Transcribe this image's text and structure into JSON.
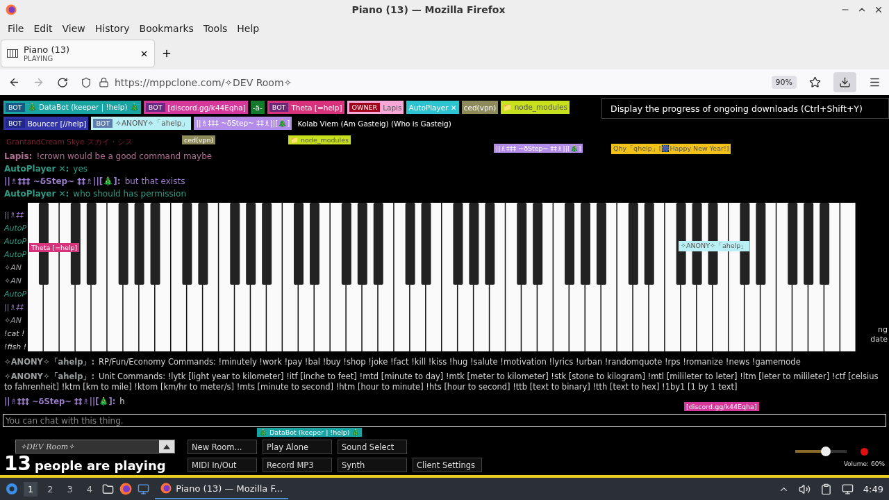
{
  "window": {
    "title": "Piano (13) — Mozilla Firefox"
  },
  "menu": [
    "File",
    "Edit",
    "View",
    "History",
    "Bookmarks",
    "Tools",
    "Help"
  ],
  "tab": {
    "title": "Piano (13)",
    "status": "PLAYING"
  },
  "address": {
    "url": "https://mppclone.com/✧DEV Room✧",
    "zoom": "90%"
  },
  "tooltip": "Display the progress of ongoing downloads (Ctrl+Shift+Y)",
  "users": [
    {
      "kind": "bot",
      "badge": "BOT",
      "name": "🎄 DataBot (keeper | !help) 🎄",
      "color": "#1aa3a3"
    },
    {
      "kind": "bot",
      "badge": "BOT",
      "name": "[discord.gg/k44Eqha]",
      "color": "#d6379b"
    },
    {
      "kind": "plain",
      "name": "-ä-",
      "color": "#127a2a"
    },
    {
      "kind": "bot",
      "badge": "BOT",
      "name": "Theta [=help]",
      "color": "#d8327d"
    },
    {
      "kind": "owner",
      "badge": "OWNER",
      "name": "Lapis",
      "color": "#f7a8d8"
    },
    {
      "kind": "plain",
      "name": "AutoPlayer ✕",
      "color": "#2ec4cf"
    },
    {
      "kind": "plain",
      "name": "ced(vpn)",
      "color": "#8f8a5a"
    },
    {
      "kind": "plain",
      "name": "📁 node_modules",
      "color": "#c8e01e"
    },
    {
      "kind": "bot",
      "badge": "BOT",
      "name": "Bouncer [//help]",
      "color": "#3034a8"
    },
    {
      "kind": "bot",
      "badge": "BOT",
      "name": "✧ANONY✧「ahelp」",
      "color": "#b8f0f5"
    },
    {
      "kind": "plain",
      "name": "||♗‡‡‡ ~δStep~ ‡‡♗||[🎄]",
      "color": "#b48de8"
    },
    {
      "kind": "text",
      "name": "Kolab Viem (Am Gasteig) (Who is Gasteig)",
      "color": "#ffffff"
    },
    {
      "kind": "text",
      "name": "GrantandCream Skye スカイ・シス",
      "color": "#7a2030"
    }
  ],
  "cursors": [
    {
      "name": "ced(vpn)",
      "color": "#8f8a5a"
    },
    {
      "name": "📁 node_modules",
      "color": "#c8e01e"
    },
    {
      "name": "||♗‡‡‡ ~δStep~ ‡‡♗||[🎄]",
      "color": "#b48de8"
    },
    {
      "name": "Qhy「qhelp」[🎆Happy New Year!]",
      "color": "#f2c21a"
    },
    {
      "name": "Theta [=help]",
      "color": "#d8327d"
    },
    {
      "name": "✧ANONY✧「ahelp」",
      "color": "#b8f0f5"
    },
    {
      "name": "[discord.gg/k44Eqha]",
      "color": "#d6379b"
    },
    {
      "name": "🎄 DataBot (keeper | !help) 🎄",
      "color": "#1aa3a3"
    }
  ],
  "chat": [
    {
      "name": "Lapis:",
      "text": "!crown would be a good command maybe",
      "color": "#b06f92"
    },
    {
      "name": "AutoPlayer ✕:",
      "text": "yes",
      "color": "#2e9c86"
    },
    {
      "name": "||♗‡‡‡ ~δStep~ ‡‡♗||[🎄]:",
      "text": "but that exists",
      "color": "#9c7ccc"
    },
    {
      "name": "AutoPlayer ✕:",
      "text": "who should has permission",
      "color": "#2e9c86"
    }
  ],
  "chat_fragments_left": [
    {
      "text": "||♗‡‡",
      "color": "#9c7ccc"
    },
    {
      "text": "AutoP",
      "color": "#2e9c86"
    },
    {
      "text": "AutoP",
      "color": "#2e9c86"
    },
    {
      "text": "AutoP",
      "color": "#2e9c86"
    },
    {
      "text": "✧AN",
      "color": "#9aa0a0"
    },
    {
      "text": "✧AN",
      "color": "#9aa0a0"
    },
    {
      "text": "AutoP",
      "color": "#2e9c86"
    },
    {
      "text": "||♗‡‡",
      "color": "#9c7ccc"
    },
    {
      "text": "✧AN",
      "color": "#9aa0a0"
    },
    {
      "text": "!cat !",
      "color": "#d8d8d8"
    },
    {
      "text": "!fish !",
      "color": "#d8d8d8"
    }
  ],
  "chat_fragments_right": [
    "ng",
    "date"
  ],
  "chat_after": [
    {
      "name": "✧ANONY✧「ahelp」:",
      "text": "RP/Fun/Economy Commands: !minutely !work !pay !bal !buy !shop !joke !fact !kill !kiss !hug !salute !motivation !lyrics !urban !randomquote !rps !romanize !news !gamemode",
      "color": "#9aa0a0"
    },
    {
      "name": "✧ANONY✧「ahelp」:",
      "text": "Unit Commands: !lytk [light year to kilometer] !itf [inche to feet] !mtd [minute to day] !mtk [meter to kilometer] !stk [stone to kilogram] !mtl [milileter to leter] !ltm [leter to milileter] !ctf [celsius to fahrenheit] !ktm [km to mile] !ktom [km/hr to meter/s] !mts [minute to second] !htm [hour to minute] !hts [hour to second] !ttb [text to binary] !tth [text to hex] !1by1 [1 by 1 text]",
      "color": "#9aa0a0"
    },
    {
      "name": "||♗‡‡‡ ~δStep~ ‡‡♗||[🎄]:",
      "text": "h",
      "color": "#9c7ccc"
    }
  ],
  "chat_input": {
    "placeholder": "You can chat with this thing."
  },
  "room": {
    "name": "✧DEV Room✧"
  },
  "player_count": {
    "number": "13",
    "label": "people are playing"
  },
  "buttons": [
    [
      "New Room...",
      "Play Alone",
      "Sound Select"
    ],
    [
      "MIDI In/Out",
      "Record MP3",
      "Synth",
      "Client Settings"
    ]
  ],
  "volume": {
    "label": "Volume: 60%",
    "level": 0.6
  },
  "taskbar": {
    "workspaces": [
      {
        "label": "1",
        "selected": true
      },
      {
        "label": "2",
        "selected": false
      },
      {
        "label": "3",
        "selected": false
      },
      {
        "label": "4",
        "selected": false
      }
    ],
    "task": "Piano (13) — Mozilla F...",
    "clock": "4:49"
  }
}
